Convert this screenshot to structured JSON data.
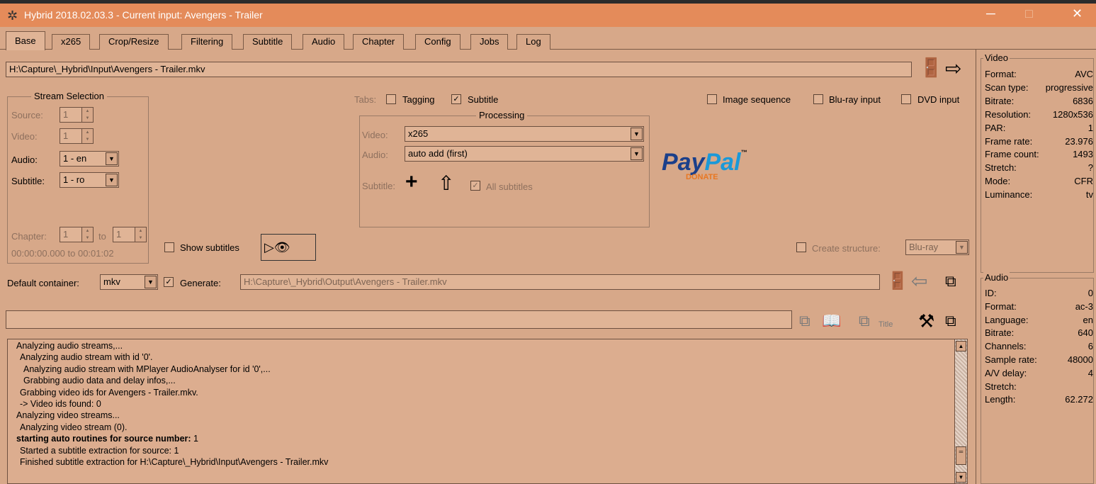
{
  "window": {
    "title": "Hybrid 2018.02.03.3 - Current input: Avengers - Trailer",
    "minimize": "─",
    "maximize": "□",
    "close": "✕"
  },
  "tabs": [
    "Base",
    "x265",
    "Crop/Resize",
    "Filtering",
    "Subtitle",
    "Audio",
    "Chapter",
    "Config",
    "Jobs",
    "Log"
  ],
  "input_path": "H:\\Capture\\_Hybrid\\Input\\Avengers - Trailer.mkv",
  "stream_selection": {
    "title": "Stream Selection",
    "source_label": "Source:",
    "source_value": "1",
    "video_label": "Video:",
    "video_value": "1",
    "audio_label": "Audio:",
    "audio_value": "1 - en",
    "subtitle_label": "Subtitle:",
    "subtitle_value": "1 - ro",
    "chapter_label": "Chapter:",
    "chapter_from": "1",
    "chapter_to_label": "to",
    "chapter_to": "1",
    "time_range": "00:00:00.000 to 00:01:02"
  },
  "tabs_options": {
    "label": "Tabs:",
    "tagging": "Tagging",
    "subtitle": "Subtitle"
  },
  "processing": {
    "title": "Processing",
    "video_label": "Video:",
    "video_value": "x265",
    "audio_label": "Audio:",
    "audio_value": "auto add (first)",
    "subtitle_label": "Subtitle:",
    "all_subtitles": "All subtitles"
  },
  "input_options": {
    "image_sequence": "Image sequence",
    "bluray_input": "Blu-ray input",
    "dvd_input": "DVD input"
  },
  "paypal": {
    "text1": "Pay",
    "text2": "Pal",
    "tm": "™",
    "sub": "DONATE"
  },
  "show_subtitles": "Show subtitles",
  "create_structure": {
    "label": "Create structure:",
    "value": "Blu-ray"
  },
  "output": {
    "container_label": "Default container:",
    "container_value": "mkv",
    "generate_label": "Generate:",
    "path": "H:\\Capture\\_Hybrid\\Output\\Avengers - Trailer.mkv"
  },
  "title_icon_label": "Title",
  "log_lines": [
    {
      "text": "Analyzing audio streams,...",
      "indent": 0,
      "bold": false
    },
    {
      "text": "Analyzing audio stream with id '0'.",
      "indent": 1,
      "bold": false
    },
    {
      "text": "Analyzing audio stream with MPlayer AudioAnalyser for id '0',...",
      "indent": 2,
      "bold": false
    },
    {
      "text": "Grabbing audio data and delay infos,...",
      "indent": 2,
      "bold": false
    },
    {
      "text": "Grabbing video ids for Avengers - Trailer.mkv.",
      "indent": 1,
      "bold": false
    },
    {
      "text": "-> Video ids found: 0",
      "indent": 1,
      "bold": false
    },
    {
      "text": "Analyzing video streams...",
      "indent": 0,
      "bold": false
    },
    {
      "text": "Analyzing video stream (0).",
      "indent": 1,
      "bold": false
    },
    {
      "text": "starting auto routines for source number:",
      "suffix": " 1",
      "indent": 0,
      "bold": true
    },
    {
      "text": "Started a subtitle extraction for source: 1",
      "indent": 1,
      "bold": false
    },
    {
      "text": "Finished subtitle extraction for H:\\Capture\\_Hybrid\\Input\\Avengers - Trailer.mkv",
      "indent": 1,
      "bold": false
    }
  ],
  "video_info": {
    "title": "Video",
    "rows": [
      {
        "k": "Format:",
        "v": "AVC"
      },
      {
        "k": "Scan type:",
        "v": "progressive"
      },
      {
        "k": "Bitrate:",
        "v": "6836"
      },
      {
        "k": "Resolution:",
        "v": "1280x536"
      },
      {
        "k": "PAR:",
        "v": "1"
      },
      {
        "k": "Frame rate:",
        "v": "23.976"
      },
      {
        "k": "Frame count:",
        "v": "1493"
      },
      {
        "k": "Stretch:",
        "v": "?"
      },
      {
        "k": "Mode:",
        "v": "CFR"
      },
      {
        "k": "Luminance:",
        "v": "tv"
      }
    ]
  },
  "audio_info": {
    "title": "Audio",
    "rows": [
      {
        "k": "ID:",
        "v": "0"
      },
      {
        "k": "Format:",
        "v": "ac-3"
      },
      {
        "k": "Language:",
        "v": "en"
      },
      {
        "k": "Bitrate:",
        "v": "640"
      },
      {
        "k": "Channels:",
        "v": "6"
      },
      {
        "k": "Sample rate:",
        "v": "48000"
      },
      {
        "k": "A/V delay:",
        "v": "4"
      },
      {
        "k": "Stretch:",
        "v": ""
      },
      {
        "k": "Length:",
        "v": "62.272"
      }
    ]
  }
}
